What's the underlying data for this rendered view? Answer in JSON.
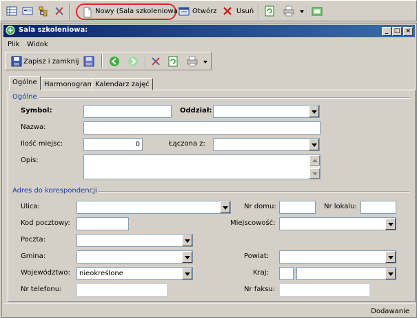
{
  "main_toolbar": {
    "new_label": "Nowy (Sala szkoleniowa)",
    "open_label": "Otwórz",
    "delete_label": "Usuń"
  },
  "window": {
    "title": "Sala szkoleniowa:",
    "menu": {
      "file": "Plik",
      "view": "Widok"
    },
    "toolbar": {
      "save_close": "Zapisz i zamknij"
    },
    "tabs": [
      "Ogólne",
      "Harmonogram",
      "Kalendarz zajęć"
    ]
  },
  "form": {
    "group_general": "Ogólne",
    "symbol_label": "Symbol:",
    "symbol_value": "",
    "branch_label": "Oddział:",
    "branch_value": "",
    "name_label": "Nazwa:",
    "name_value": "",
    "seats_label": "Ilość miejsc:",
    "seats_value": "0",
    "joined_label": "Łączona z:",
    "joined_value": "",
    "desc_label": "Opis:",
    "desc_value": "",
    "group_address": "Adres do korespondencji",
    "street_label": "Ulica:",
    "street_value": "",
    "house_label": "Nr domu:",
    "house_value": "",
    "apt_label": "Nr lokalu:",
    "apt_value": "",
    "postcode_label": "Kod pocztowy:",
    "postcode_value": "",
    "city_label": "Miejscowość:",
    "city_value": "",
    "post_label": "Poczta:",
    "post_value": "",
    "commune_label": "Gmina:",
    "commune_value": "",
    "county_label": "Powiat:",
    "county_value": "",
    "voivodeship_label": "Województwo:",
    "voivodeship_value": "nieokreślone",
    "country_label": "Kraj:",
    "country_code": "",
    "country_value": "",
    "phone_label": "Nr telefonu:",
    "phone_value": "",
    "fax_label": "Nr faksu:",
    "fax_value": ""
  },
  "status": {
    "mode": "Dodawanie"
  },
  "colors": {
    "titlebar": "#0a246a",
    "highlight_ring": "#e0282a",
    "group_text": "#1b3c9e"
  }
}
